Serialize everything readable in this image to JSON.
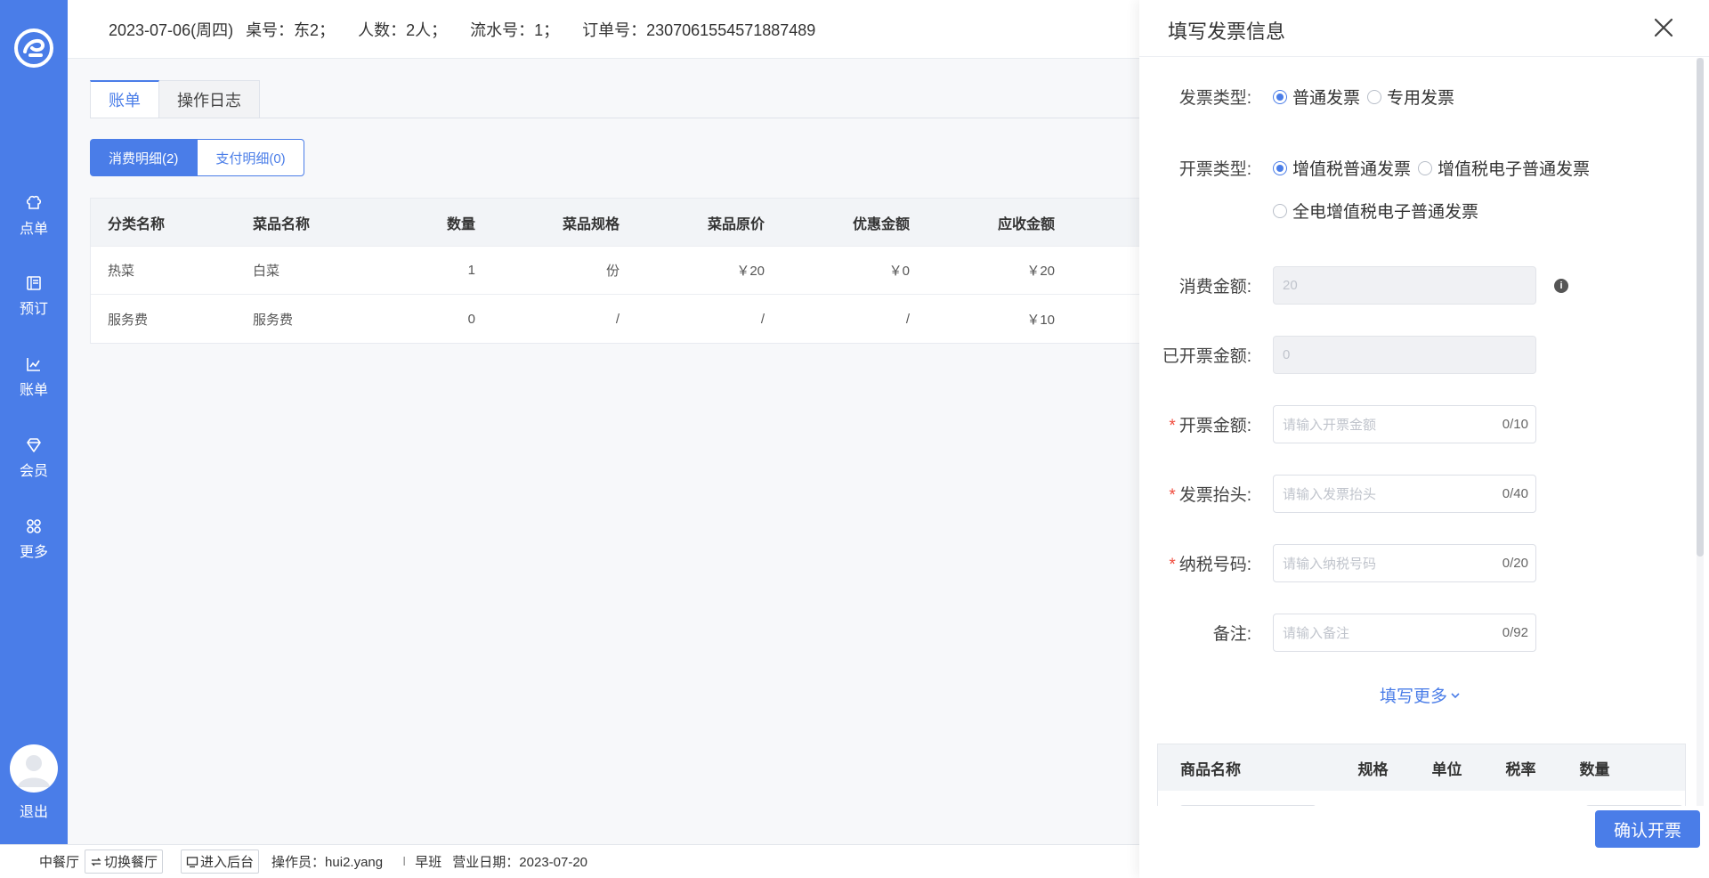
{
  "sidebar": {
    "items": [
      {
        "label": "点单",
        "icon": "chef-hat-icon"
      },
      {
        "label": "预订",
        "icon": "book-icon"
      },
      {
        "label": "账单",
        "icon": "chart-icon"
      },
      {
        "label": "会员",
        "icon": "diamond-icon"
      },
      {
        "label": "更多",
        "icon": "grid-icon"
      }
    ],
    "logout_label": "退出"
  },
  "header": {
    "date": "2023-07-06(周四)",
    "table": "桌号：东2；",
    "people": "人数：2人；",
    "serial": "流水号：1；",
    "order": "订单号：2307061554571887489"
  },
  "main": {
    "tabs": [
      {
        "label": "账单",
        "active": true
      },
      {
        "label": "操作日志",
        "active": false
      }
    ],
    "subtabs": [
      {
        "label": "消费明细(2)",
        "active": true
      },
      {
        "label": "支付明细(0)",
        "active": false
      }
    ],
    "table": {
      "columns": [
        "分类名称",
        "菜品名称",
        "数量",
        "菜品规格",
        "菜品原价",
        "优惠金额",
        "应收金额"
      ],
      "rows": [
        [
          "热菜",
          "白菜",
          "1",
          "份",
          "￥20",
          "￥0",
          "￥20"
        ],
        [
          "服务费",
          "服务费",
          "0",
          "/",
          "/",
          "/",
          "￥10"
        ]
      ]
    }
  },
  "statusbar": {
    "hall": "中餐厅",
    "switch_label": "切换餐厅",
    "backend_label": "进入后台",
    "operator": "操作员：hui2.yang",
    "separator": "I",
    "shift": "早班",
    "business_date": "营业日期：2023-07-20"
  },
  "drawer": {
    "title": "填写发票信息",
    "invoice_type": {
      "label": "发票类型:",
      "options": [
        {
          "label": "普通发票",
          "checked": true
        },
        {
          "label": "专用发票",
          "checked": false
        }
      ]
    },
    "issue_type": {
      "label": "开票类型:",
      "options": [
        {
          "label": "增值税普通发票",
          "checked": true
        },
        {
          "label": "增值税电子普通发票",
          "checked": false
        },
        {
          "label": "全电增值税电子普通发票",
          "checked": false
        }
      ]
    },
    "consume_amount": {
      "label": "消费金额:",
      "value": "20"
    },
    "invoiced_amount": {
      "label": "已开票金额:",
      "value": "0"
    },
    "invoice_amount": {
      "label": "开票金额:",
      "placeholder": "请输入开票金额",
      "counter": "0/10"
    },
    "invoice_title": {
      "label": "发票抬头:",
      "placeholder": "请输入发票抬头",
      "counter": "0/40"
    },
    "tax_number": {
      "label": "纳税号码:",
      "placeholder": "请输入纳税号码",
      "counter": "0/20"
    },
    "remark": {
      "label": "备注:",
      "placeholder": "请输入备注",
      "counter": "0/92"
    },
    "more_label": "填写更多",
    "goods_table": {
      "columns": [
        "商品名称",
        "规格",
        "单位",
        "税率",
        "数量"
      ]
    },
    "confirm_label": "确认开票"
  },
  "colors": {
    "accent": "#4a7de8",
    "required": "#f04b3d"
  }
}
